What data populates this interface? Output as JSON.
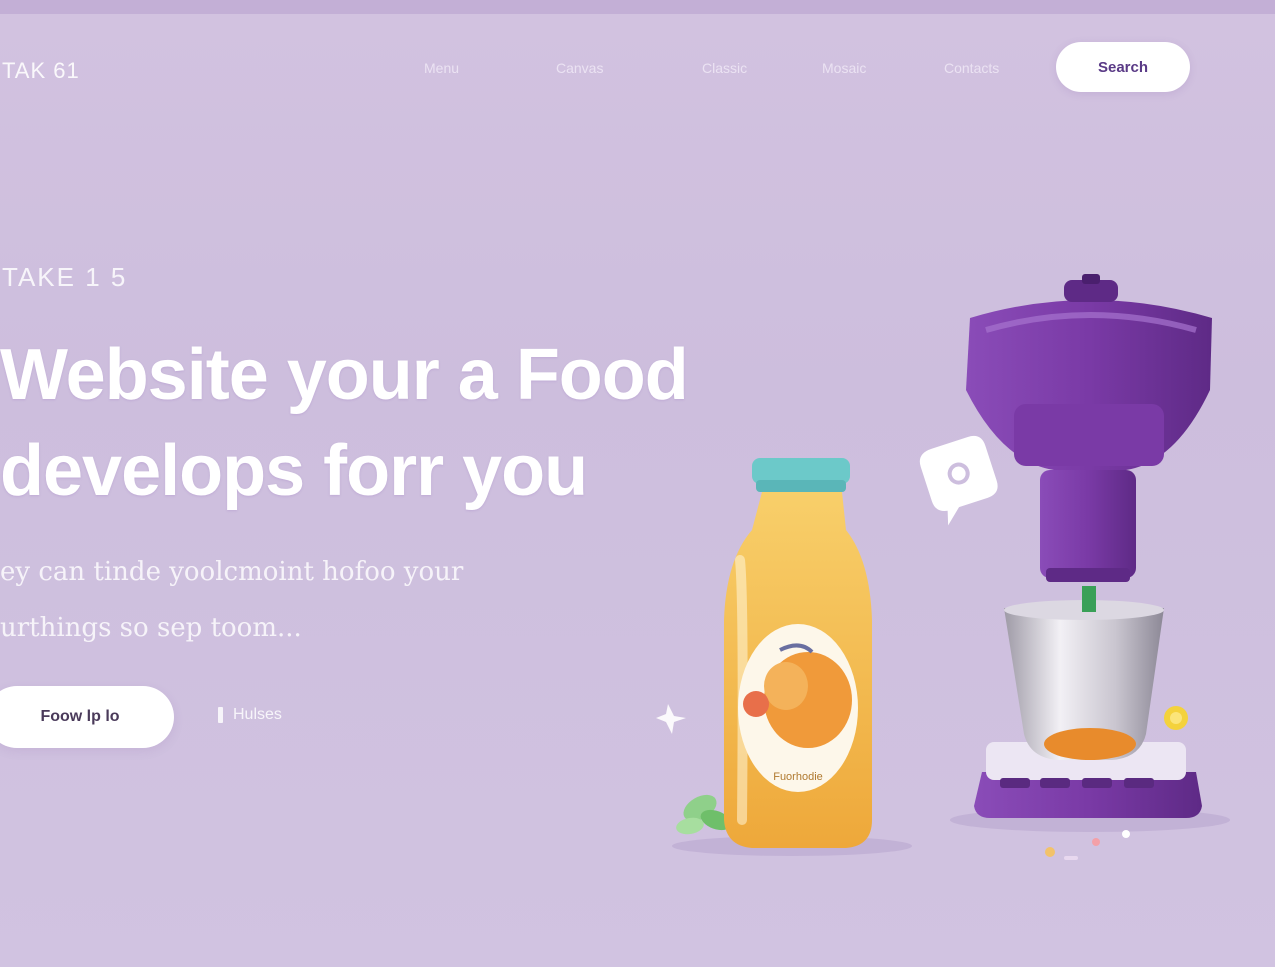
{
  "brand": {
    "logo_text": "TAK 61"
  },
  "nav": {
    "links": [
      "Menu",
      "Canvas",
      "Classic",
      "Mosaic",
      "Contacts"
    ],
    "cta_label": "Search"
  },
  "hero": {
    "eyebrow": "TAKE 1 5",
    "headline_line1": "Website your a Food",
    "headline_line2": "develops forr you",
    "description_line1": "ey can tinde yoolcmoint hofoo your",
    "description_line2": "urthings so sep toom...",
    "primary_button": "Foow lp lo",
    "secondary_button": "Hulses"
  },
  "illustration": {
    "bottle_label": "Fuorhodie",
    "icons": [
      "juice-bottle-icon",
      "blender-icon",
      "chat-bubble-icon",
      "sparkle-icon",
      "leaf-icon"
    ],
    "colors": {
      "background": "#cfc0de",
      "blender_purple": "#7b3fa8",
      "juice_orange": "#f2b94a",
      "bottle_cap": "#6cc9c9"
    }
  }
}
